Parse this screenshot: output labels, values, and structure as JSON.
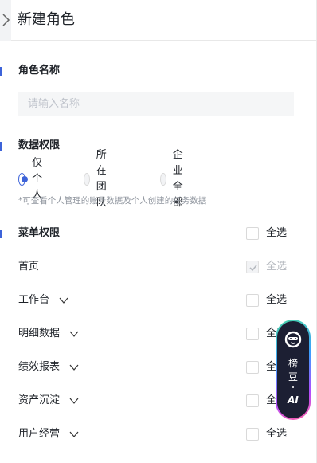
{
  "header": {
    "title": "新建角色",
    "back_icon": "chevron-left-icon"
  },
  "role_name": {
    "title": "角色名称",
    "placeholder": "请输入名称",
    "value": ""
  },
  "data_permission": {
    "title": "数据权限",
    "options": [
      {
        "label": "仅个人",
        "checked": true
      },
      {
        "label": "所在团队",
        "checked": false
      },
      {
        "label": "企业全部",
        "checked": false
      }
    ],
    "hint": "*可查看个人管理的账号数据及个人创建的任务数据"
  },
  "menu_permission": {
    "title": "菜单权限",
    "select_all_label": "全选",
    "items": [
      {
        "label": "首页",
        "expandable": false,
        "checked": true,
        "disabled": true,
        "select_label": "全选"
      },
      {
        "label": "工作台",
        "expandable": true,
        "checked": false,
        "disabled": false,
        "select_label": "全选"
      },
      {
        "label": "明细数据",
        "expandable": true,
        "checked": false,
        "disabled": false,
        "select_label": "全选"
      },
      {
        "label": "绩效报表",
        "expandable": true,
        "checked": false,
        "disabled": false,
        "select_label": "全选"
      },
      {
        "label": "资产沉淀",
        "expandable": true,
        "checked": false,
        "disabled": false,
        "select_label": "全选"
      },
      {
        "label": "用户经营",
        "expandable": true,
        "checked": false,
        "disabled": false,
        "select_label": "全选"
      }
    ]
  },
  "ai_assistant": {
    "line1": "榜",
    "line2": "豆",
    "line3": "AI",
    "icon": "robot-face-icon"
  },
  "colors": {
    "accent": "#3d63d9",
    "text": "#1f2329",
    "muted": "#8f959e",
    "disabled": "#b5b9bf"
  }
}
